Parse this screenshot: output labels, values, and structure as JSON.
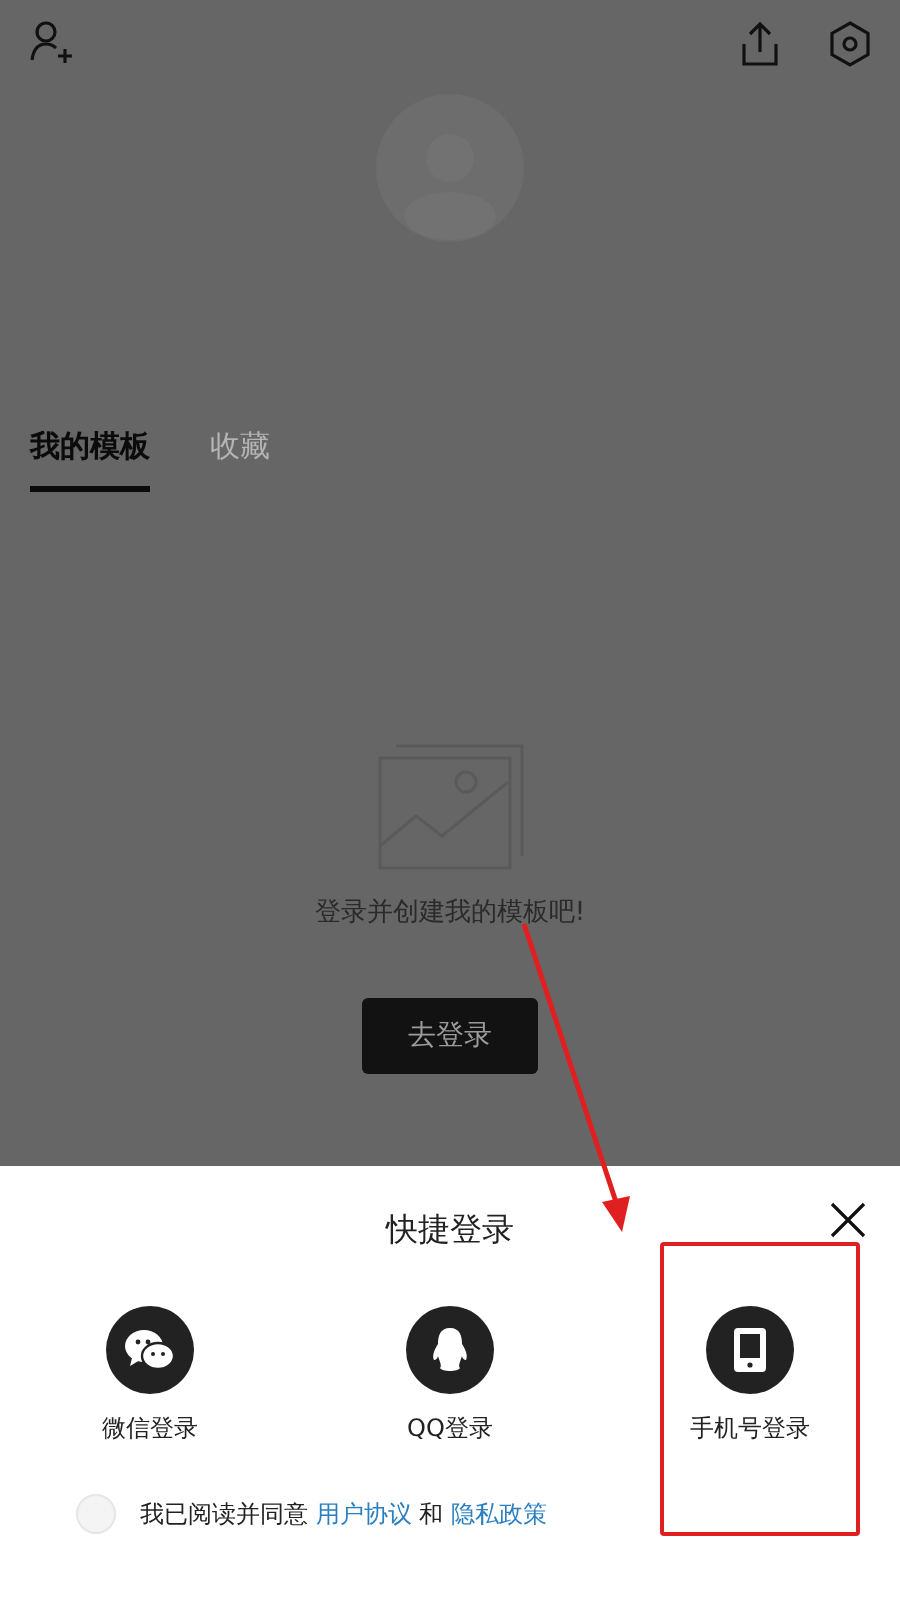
{
  "tabs": [
    {
      "label": "我的模板",
      "selected": true
    },
    {
      "label": "收藏",
      "selected": false
    }
  ],
  "empty_state": {
    "message": "登录并创建我的模板吧!",
    "button": "去登录"
  },
  "login_sheet": {
    "title": "快捷登录",
    "options": [
      {
        "kind": "wechat",
        "label": "微信登录",
        "highlighted": false
      },
      {
        "kind": "qq",
        "label": "QQ登录",
        "highlighted": false
      },
      {
        "kind": "phone",
        "label": "手机号登录",
        "highlighted": true
      }
    ],
    "agreement": {
      "checked": false,
      "parts": [
        {
          "kind": "text",
          "text": "我已阅读并同意"
        },
        {
          "kind": "link",
          "text": "用户协议"
        },
        {
          "kind": "text",
          "text": "和"
        },
        {
          "kind": "link",
          "text": "隐私政策"
        }
      ]
    }
  }
}
